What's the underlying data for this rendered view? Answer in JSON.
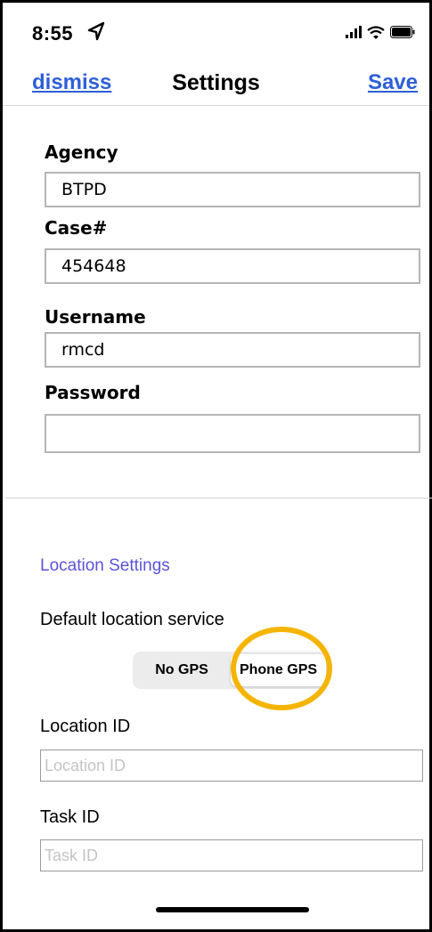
{
  "status_bar": {
    "time": "8:55",
    "icons": [
      "location-arrow-icon",
      "signal-bars-icon",
      "wifi-icon",
      "battery-icon"
    ]
  },
  "nav": {
    "dismiss_label": "dismiss",
    "title": "Settings",
    "save_label": "Save"
  },
  "form": {
    "agency": {
      "label": "Agency",
      "value": "BTPD"
    },
    "case": {
      "label": "Case#",
      "value": "454648"
    },
    "username": {
      "label": "Username",
      "value": "rmcd"
    },
    "password": {
      "label": "Password",
      "value": ""
    }
  },
  "location": {
    "section_title": "Location Settings",
    "default_service_label": "Default location service",
    "service_options": [
      "No GPS",
      "Phone GPS"
    ],
    "selected_service": "Phone GPS",
    "location_id": {
      "label": "Location ID",
      "placeholder": "Location ID",
      "value": ""
    },
    "task_id": {
      "label": "Task ID",
      "placeholder": "Task ID",
      "value": ""
    }
  },
  "colors": {
    "link": "#2f5fd8",
    "section_header": "#5b54d6",
    "highlight_ring": "#f5b400"
  }
}
